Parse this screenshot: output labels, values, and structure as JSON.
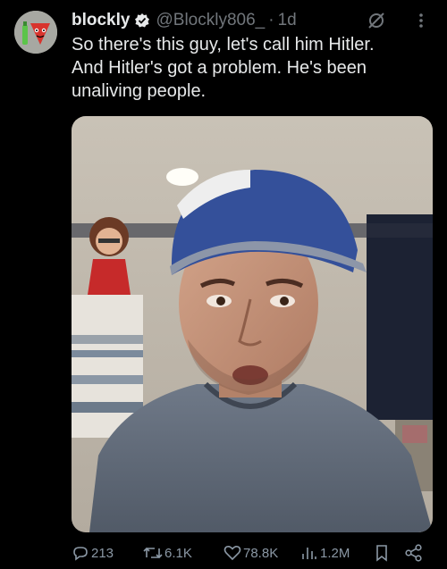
{
  "author": {
    "display_name": "blockly",
    "handle": "@Blockly806_",
    "separator": "·",
    "time_ago": "1d"
  },
  "tweet": {
    "lines": [
      "So there's this guy, let's call him Hitler.",
      "And Hitler's got a problem. He's been",
      "unaliving people."
    ]
  },
  "actions": {
    "reply_count": "213",
    "retweet_count": "6.1K",
    "like_count": "78.8K",
    "view_count": "1.2M"
  },
  "colors": {
    "background": "#000000",
    "text": "#e7e9ea",
    "muted": "#71767b",
    "action": "#8b98a5"
  },
  "icons": [
    "verified-badge-icon",
    "grok-icon",
    "more-icon",
    "reply-icon",
    "retweet-icon",
    "like-icon",
    "views-icon",
    "bookmark-icon",
    "share-icon"
  ]
}
